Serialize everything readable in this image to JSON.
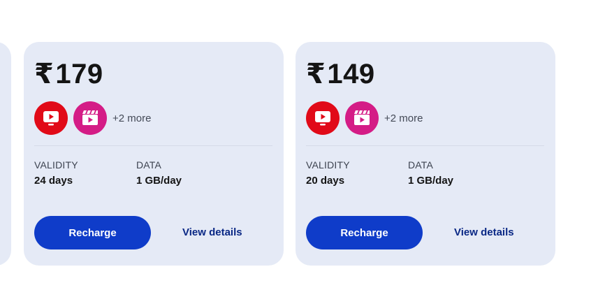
{
  "plans": [
    {
      "currency": "₹",
      "price": "179",
      "apps": [
        "jiotv-icon",
        "jiocinema-icon"
      ],
      "more_label": "+2 more",
      "validity_label": "VALIDITY",
      "validity_value": "24 days",
      "data_label": "DATA",
      "data_value": "1 GB/day",
      "recharge_label": "Recharge",
      "details_label": "View details"
    },
    {
      "currency": "₹",
      "price": "149",
      "apps": [
        "jiotv-icon",
        "jiocinema-icon"
      ],
      "more_label": "+2 more",
      "validity_label": "VALIDITY",
      "validity_value": "20 days",
      "data_label": "DATA",
      "data_value": "1 GB/day",
      "recharge_label": "Recharge",
      "details_label": "View details"
    }
  ],
  "colors": {
    "card_bg": "#e5eaf6",
    "primary_button": "#0f3cc9",
    "link": "#0a2885",
    "tv_app": "#e10a18",
    "cinema_app": "#d41c86"
  }
}
